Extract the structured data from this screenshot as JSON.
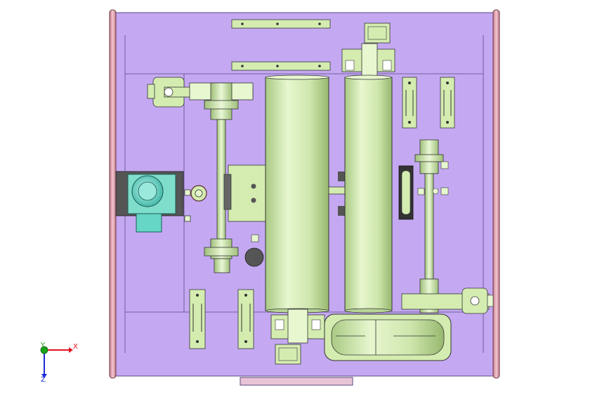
{
  "window": {
    "background": "#ffffff"
  },
  "colors": {
    "plate": "#c4a9f2",
    "plate_stroke": "#5a4a80",
    "green": "#d4ecb0",
    "green_dark": "#9bbf73",
    "cyan": "#66d6c6",
    "pink": "#e9a6b4",
    "dark": "#222222",
    "axis_x": "#e0141e",
    "axis_y": "#1aa31a",
    "axis_z": "#1a2ad6"
  },
  "axes_triad": {
    "x_label": "X",
    "y_label": "Y",
    "z_label": "Z"
  },
  "icons": [
    "triad-axis-icon"
  ]
}
